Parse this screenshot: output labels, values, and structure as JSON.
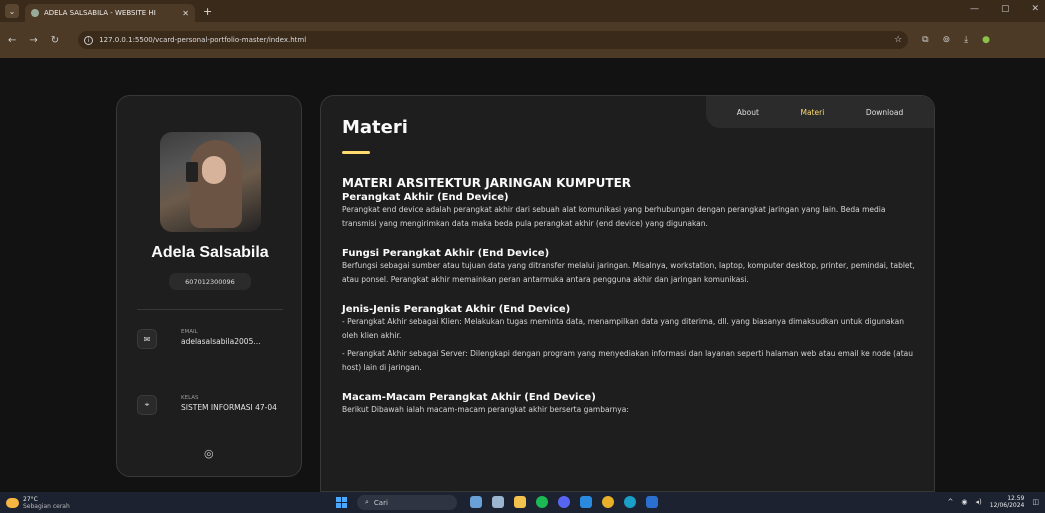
{
  "browser": {
    "tab_title": "ADELA SALSABILA - WEBSITE HI",
    "url": "127.0.0.1:5500/vcard-personal-portfolio-master/index.html"
  },
  "profile": {
    "name": "Adela Salsabila",
    "nim": "607012300096",
    "email_label": "EMAIL",
    "email_value": "adelasalsabila2005...",
    "kelas_label": "KELAS",
    "kelas_value": "SISTEM INFORMASI 47-04"
  },
  "nav": {
    "about": "About",
    "materi": "Materi",
    "download": "Download"
  },
  "article": {
    "title": "Materi",
    "heading": "MATERI ARSITEKTUR JARINGAN KUMPUTER",
    "s1_title": "Perangkat Akhir (End Device)",
    "s1_text": "Perangkat end device adalah perangkat akhir dari sebuah alat komunikasi yang berhubungan dengan perangkat jaringan yang lain. Beda media transmisi yang mengirimkan data maka beda pula perangkat akhir (end device) yang digunakan.",
    "s2_title": "Fungsi Perangkat Akhir (End Device)",
    "s2_text": "Berfungsi sebagai sumber atau tujuan data yang ditransfer melalui jaringan. Misalnya, workstation, laptop, komputer desktop, printer, pemindai, tablet, atau ponsel. Perangkat akhir memainkan peran antarmuka antara pengguna akhir dan jaringan komunikasi.",
    "s3_title": "Jenis-Jenis Perangkat Akhir (End Device)",
    "s3_text1": "- Perangkat Akhir sebagai Klien: Melakukan tugas meminta data, menampilkan data yang diterima, dll. yang biasanya dimaksudkan untuk digunakan oleh klien akhir.",
    "s3_text2": "- Perangkat Akhir sebagai Server: Dilengkapi dengan program yang menyediakan informasi dan layanan seperti halaman web atau email ke node (atau host) lain di jaringan.",
    "s4_title": "Macam-Macam Perangkat Akhir (End Device)",
    "s4_text": "Berikut Dibawah ialah macam-macam perangkat akhir berserta gambarnya:"
  },
  "taskbar": {
    "temp": "27°C",
    "weather": "Sebagian cerah",
    "search": "Cari",
    "time": "12.59",
    "date": "12/06/2024"
  },
  "colors": {
    "accent": "#ffdb70",
    "bg": "#121212",
    "card": "#1e1e1f"
  }
}
